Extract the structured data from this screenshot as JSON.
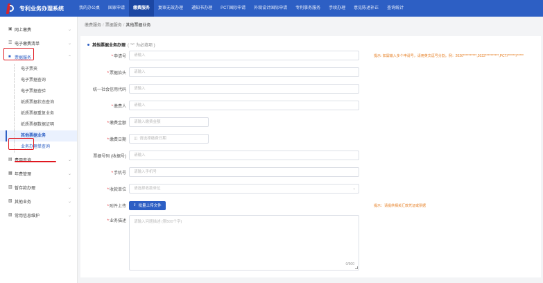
{
  "header": {
    "app_title": "专利业务办理系统",
    "nav": [
      "我的办公桌",
      "国家申请",
      "缴费服务",
      "复审无效办理",
      "通知书办理",
      "PCT国际申请",
      "外观设计国际申请",
      "专利事务服务",
      "手续办理",
      "意见陈述补正",
      "查询统计"
    ],
    "active_nav": "缴费服务"
  },
  "sidebar": {
    "items": [
      {
        "icon": "wallet-icon",
        "label": "网上缴费"
      },
      {
        "icon": "list-icon",
        "label": "电子缴费清单"
      },
      {
        "icon": "invoice-icon",
        "label": "票据服务"
      }
    ],
    "sub_items": [
      "电子票夹",
      "电子票据查询",
      "电子票据查验",
      "纸质票据状态查询",
      "纸质票据重复业务",
      "纸质票据数据证明",
      "其他票据业务",
      "业务办理单查询"
    ],
    "active_sub": "其他票据业务",
    "items_after": [
      {
        "icon": "fee-icon",
        "label": "费用查询"
      },
      {
        "icon": "doc-icon",
        "label": "年费管理"
      },
      {
        "icon": "pause-icon",
        "label": "暂存款办理"
      },
      {
        "icon": "other-icon",
        "label": "其他业务"
      },
      {
        "icon": "user-icon",
        "label": "常用信息维护"
      }
    ]
  },
  "breadcrumb": {
    "a": "缴费服务",
    "b": "票据服务",
    "c": "其他票据业务"
  },
  "form": {
    "title": "其他票据业务办理",
    "subtitle": "( \"*\" 为必填项 )",
    "fields": {
      "apply_no": {
        "label": "申请号",
        "placeholder": "请输入"
      },
      "invoice_title": {
        "label": "票据抬头",
        "placeholder": "请输入"
      },
      "credit_code": {
        "label": "统一社会信用代码",
        "placeholder": "请输入"
      },
      "payer": {
        "label": "缴费人",
        "placeholder": "请输入"
      },
      "amount": {
        "label": "缴费金额",
        "placeholder": "请输入缴费金额"
      },
      "pay_date": {
        "label": "缴费日期",
        "placeholder": "请选择缴费日期"
      },
      "receipt_no": {
        "label": "票据号码 (收据号)",
        "placeholder": "请输入"
      },
      "phone": {
        "label": "手机号",
        "placeholder": "请输入手机号"
      },
      "payee": {
        "label": "收款单位",
        "placeholder": "请选择收款单位"
      },
      "attachment": {
        "label": "附件上传",
        "button": "批量上传文件"
      },
      "description": {
        "label": "业务描述",
        "placeholder": "请输入问题描述 (限500个字)",
        "count": "0/500"
      }
    },
    "hint_apply": "提示: 如需输入多个申请号，请用英文逗号分割。例：2020**********,2022**********,PCT/******/*****",
    "hint_attachment": "提示：请提供相关汇款凭证或票据"
  }
}
